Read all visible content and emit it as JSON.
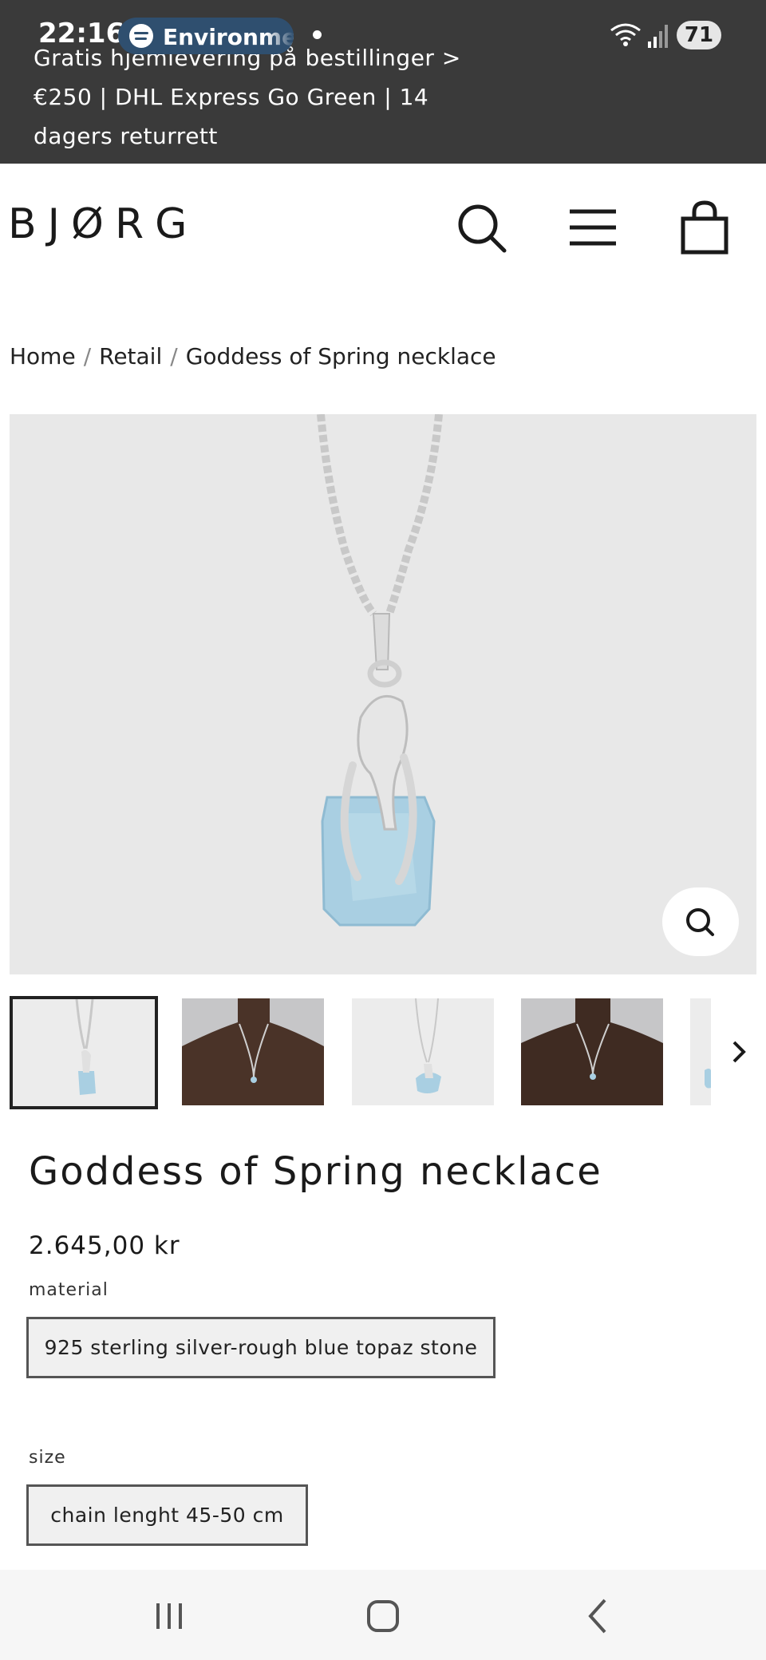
{
  "status_bar": {
    "time": "22:16",
    "media_app_label": "Environment",
    "battery_level": "71"
  },
  "announcement": {
    "text": "Gratis hjemlevering på bestillinger > €250 | DHL Express Go Green | 14 dagers returrett"
  },
  "header": {
    "logo": "BJØRG",
    "icons": [
      "search-icon",
      "menu-icon",
      "shopping-bag-icon"
    ]
  },
  "breadcrumb": {
    "items": [
      "Home",
      "Retail",
      "Goddess of Spring necklace"
    ],
    "separator": "/"
  },
  "product": {
    "title": "Goddess of Spring necklace",
    "price": "2.645,00 kr",
    "options": [
      {
        "label": "material",
        "value": "925 sterling silver-rough blue topaz stone"
      },
      {
        "label": "size",
        "value": "chain lenght 45-50 cm"
      }
    ]
  },
  "gallery": {
    "thumbnail_count": 5,
    "active_index": 0
  },
  "colors": {
    "top_bar": "#3a3a3a",
    "image_background": "#e8e8e8",
    "stone_blue": "#a9cfe2",
    "silver": "#d9d9d9",
    "text": "#1a1a1a"
  }
}
